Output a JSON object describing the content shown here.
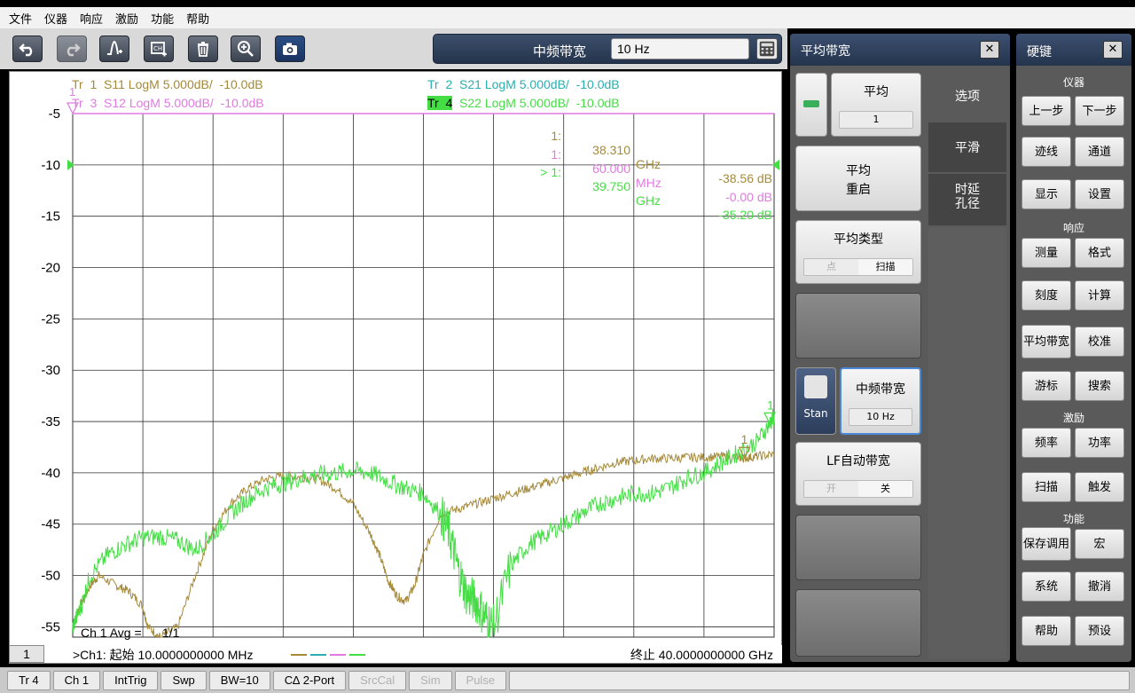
{
  "menu": [
    "文件",
    "仪器",
    "响应",
    "激励",
    "功能",
    "帮助"
  ],
  "toolbar": {
    "icons": [
      "undo-icon",
      "redo-icon",
      "marker-add-icon",
      "channel-icon",
      "trash-icon",
      "zoom-icon",
      "camera-icon"
    ],
    "if_label": "中频带宽",
    "if_value": "10 Hz"
  },
  "traces": [
    {
      "label": "Tr  1",
      "def": "S11 LogM 5.000dB/  -10.0dB",
      "color": "#a58a3a"
    },
    {
      "label": "Tr  2",
      "def": "S21 LogM 5.000dB/  -10.0dB",
      "color": "#2aaeb0"
    },
    {
      "label": "Tr  3",
      "def": "S12 LogM 5.000dB/  -10.0dB",
      "color": "#e07ae0"
    },
    {
      "label": "Tr  4",
      "def": "S22 LogM 5.000dB/  -10.0dB",
      "color": "#44dd44"
    }
  ],
  "markers": [
    {
      "idx": "1:",
      "freq": "38.310",
      "unit": "GHz",
      "val": "-38.56 dB",
      "color": "#a58a3a"
    },
    {
      "idx": "1:",
      "freq": "60.000",
      "unit": "MHz",
      "val": "-0.00 dB",
      "color": "#e07ae0"
    },
    {
      "idx": "> 1:",
      "freq": "39.750",
      "unit": "GHz",
      "val": "-35.20 dB",
      "color": "#44dd44"
    }
  ],
  "chart_data": {
    "type": "line",
    "y_ticks": [
      "-5",
      "-10",
      "-15",
      "-20",
      "-25",
      "-30",
      "-35",
      "-40",
      "-45",
      "-50",
      "-55"
    ],
    "ylim": [
      -56,
      -5
    ],
    "xlim": [
      0.01,
      40
    ],
    "series": [
      {
        "name": "Tr 1",
        "color": "#a58a3a",
        "x": [
          0.01,
          0.4,
          1.0,
          1.5,
          2.5,
          3.2,
          4.0,
          4.3,
          5,
          6,
          7,
          8,
          9,
          10,
          11,
          12,
          13,
          14,
          15,
          16,
          17,
          17.5,
          18,
          18.5,
          19,
          19.5,
          20,
          21,
          22,
          23,
          24,
          25,
          26,
          27,
          28,
          29,
          30,
          31,
          32,
          33,
          34,
          35,
          36,
          37,
          38,
          38.3,
          39,
          40
        ],
        "y": [
          -55,
          -53,
          -51,
          -50,
          -51,
          -51.5,
          -53,
          -55,
          -56,
          -55,
          -50,
          -45.5,
          -43,
          -41.5,
          -40.6,
          -40.3,
          -40.4,
          -40.6,
          -41.5,
          -43,
          -46,
          -48,
          -50.5,
          -52,
          -52.5,
          -51,
          -48,
          -44,
          -43.5,
          -43,
          -42.5,
          -42,
          -41.5,
          -41,
          -40.5,
          -40,
          -39.5,
          -39,
          -38.8,
          -38.6,
          -38.6,
          -38.5,
          -38.5,
          -38.4,
          -38.5,
          -38.56,
          -38.4,
          -38.2
        ]
      },
      {
        "name": "Tr 4",
        "color": "#44dd44",
        "x": [
          0.01,
          0.5,
          1,
          2,
          3,
          4,
          5,
          6,
          7,
          8,
          9,
          10,
          11,
          12,
          13,
          14,
          15,
          16,
          17,
          18,
          19,
          20,
          21,
          21.5,
          22,
          22.5,
          23,
          23.5,
          24,
          25,
          26,
          27,
          28,
          29,
          30,
          31,
          32,
          33,
          34,
          35,
          36,
          37,
          38,
          39,
          39.75,
          40
        ],
        "y": [
          -55,
          -53,
          -50,
          -48,
          -47,
          -46.3,
          -46.2,
          -46.6,
          -47.5,
          -46,
          -44,
          -42.5,
          -41.5,
          -41,
          -40.5,
          -40.2,
          -40.0,
          -39.8,
          -40.0,
          -40.8,
          -41.5,
          -42,
          -44,
          -46,
          -49.5,
          -52,
          -52.5,
          -54,
          -55,
          -49,
          -47,
          -46,
          -45,
          -44,
          -43,
          -42.5,
          -42,
          -42,
          -41.5,
          -40.5,
          -40,
          -39,
          -38,
          -37,
          -35.2,
          -34.5
        ]
      }
    ]
  },
  "status": {
    "channel_num": "1",
    "avg": "Ch 1 Avg =      1/1",
    "start": ">Ch1:  起始   10.0000000000 MHz",
    "stop": "终止  40.0000000000 GHz"
  },
  "bottom_tabs": [
    {
      "label": "Tr 4",
      "dis": false
    },
    {
      "label": "Ch 1",
      "dis": false
    },
    {
      "label": "IntTrig",
      "dis": false
    },
    {
      "label": "Swp",
      "dis": false
    },
    {
      "label": "BW=10",
      "dis": false
    },
    {
      "label": "C∆ 2-Port",
      "dis": false
    },
    {
      "label": "SrcCal",
      "dis": true
    },
    {
      "label": "Sim",
      "dis": true
    },
    {
      "label": "Pulse",
      "dis": true
    }
  ],
  "softpanel": {
    "title": "平均带宽",
    "avg_label": "平均",
    "avg_value": "1",
    "avg_restart_1": "平均",
    "avg_restart_2": "重启",
    "avg_type": "平均类型",
    "avg_type_opt1": "点",
    "avg_type_opt2": "扫描",
    "stan": "Stan",
    "if_bw": "中频带宽",
    "if_bw_value": "10 Hz",
    "lf_auto": "LF自动带宽",
    "lf_opt1": "开",
    "lf_opt2": "关",
    "tab_options": "选项",
    "tab_smooth": "平滑",
    "tab_delay_1": "时延",
    "tab_delay_2": "孔径"
  },
  "hardkeys": {
    "title": "硬键",
    "sec_instrument": "仪器",
    "sec_response": "响应",
    "sec_stimulus": "激励",
    "sec_function": "功能",
    "keys": [
      "上一步",
      "下一步",
      "迹线",
      "通道",
      "显示",
      "设置",
      "测量",
      "格式",
      "刻度",
      "计算",
      "平均带宽",
      "校准",
      "游标",
      "搜索",
      "频率",
      "功率",
      "扫描",
      "触发",
      "保存调用",
      "宏",
      "系统",
      "撤消",
      "帮助",
      "预设"
    ]
  }
}
